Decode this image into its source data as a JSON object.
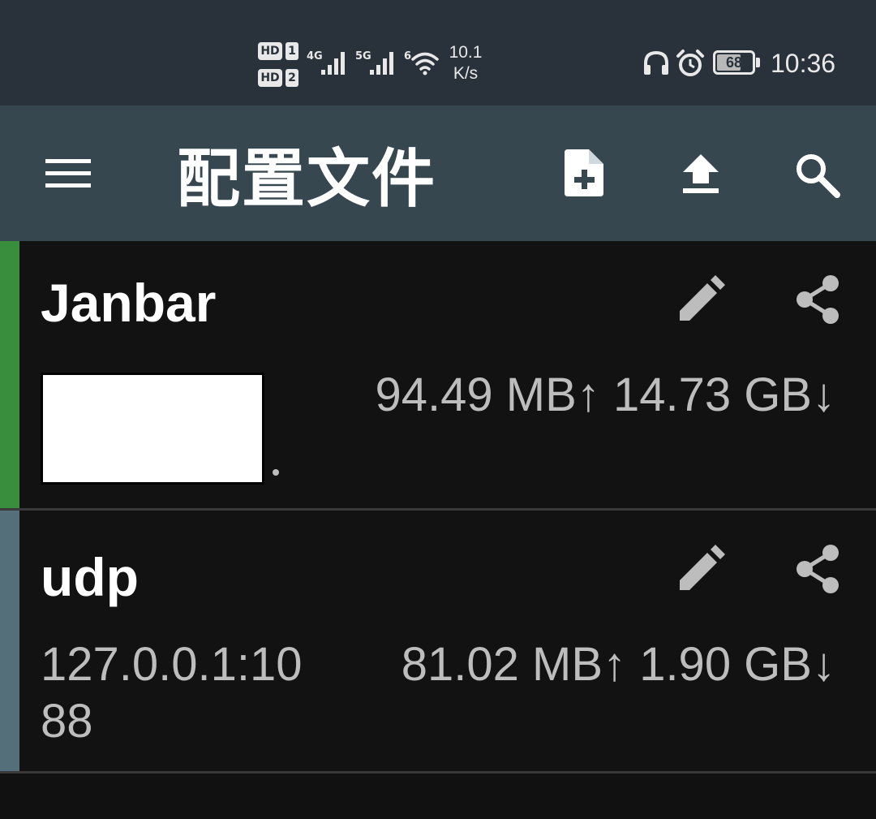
{
  "status_bar": {
    "sim1_tag": "HD",
    "sim1_num": "1",
    "sim2_tag": "HD",
    "sim2_num": "2",
    "net1": "4G",
    "net2": "5G",
    "wifi_gen": "6",
    "speed_value": "10.1",
    "speed_unit": "K/s",
    "battery": "68",
    "battery_level": 0.68,
    "time": "10:36",
    "icons": [
      "headphones-icon",
      "alarm-icon",
      "battery-icon",
      "wifi-icon",
      "signal-icon"
    ]
  },
  "app_bar": {
    "title": "配置文件",
    "icons": [
      "menu-icon",
      "new-file-icon",
      "upload-icon",
      "search-icon"
    ]
  },
  "profiles": [
    {
      "name": "Janbar",
      "address": "",
      "address_redacted": true,
      "upload": "94.49 MB↑",
      "download": "14.73 GB↓",
      "accent": "#388e3c",
      "active": true
    },
    {
      "name": "udp",
      "address_line1": "127.0.0.1:10",
      "address_line2": "88",
      "upload": "81.02 MB↑",
      "download": "1.90 GB↓",
      "accent": "#546e7a",
      "active": false
    }
  ],
  "colors": {
    "status_bar_bg": "#29323a",
    "app_bar_bg": "#37474f",
    "background": "#111111",
    "text_secondary": "#bdbdbd"
  }
}
